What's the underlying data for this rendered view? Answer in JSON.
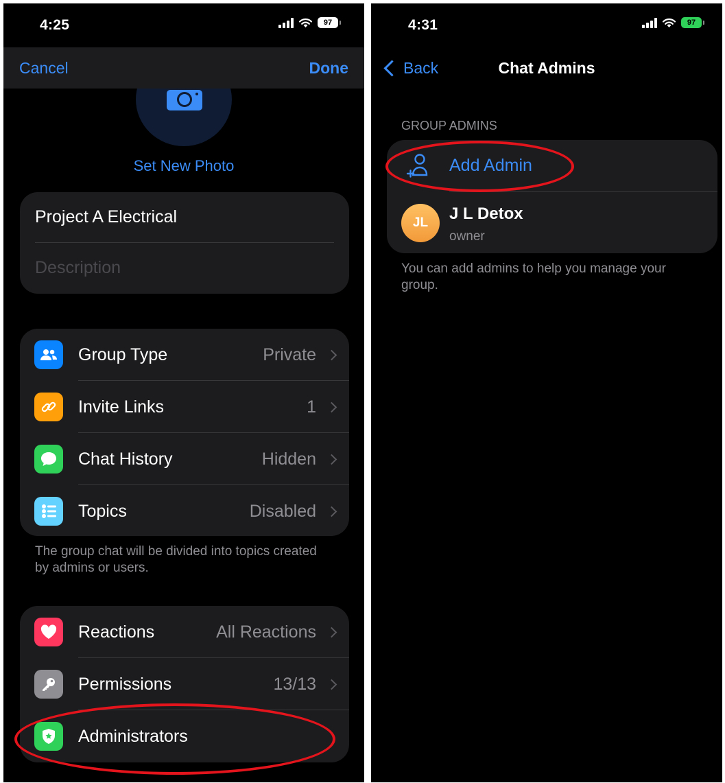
{
  "left_screen": {
    "status": {
      "time": "4:25",
      "battery": "97"
    },
    "nav": {
      "cancel_label": "Cancel",
      "done_label": "Done"
    },
    "photo": {
      "set_new_photo_label": "Set New Photo"
    },
    "name_field": {
      "value": "Project A Electrical",
      "description_placeholder": "Description"
    },
    "settings": [
      {
        "label": "Group Type",
        "value": "Private",
        "icon": "group-icon",
        "color": "#0a84ff"
      },
      {
        "label": "Invite Links",
        "value": "1",
        "icon": "link-icon",
        "color": "#ff9f0a"
      },
      {
        "label": "Chat History",
        "value": "Hidden",
        "icon": "chat-bubble-icon",
        "color": "#30d158"
      },
      {
        "label": "Topics",
        "value": "Disabled",
        "icon": "topics-list-icon",
        "color": "#64d2ff"
      }
    ],
    "topics_footnote": "The group chat will be divided into topics created by admins or users.",
    "admin_settings": [
      {
        "label": "Reactions",
        "value": "All Reactions",
        "icon": "heart-icon",
        "color": "#ff375f"
      },
      {
        "label": "Permissions",
        "value": "13/13",
        "icon": "key-icon",
        "color": "#8e8e93"
      },
      {
        "label": "Administrators",
        "value": "",
        "icon": "shield-icon",
        "color": "#30d158"
      }
    ]
  },
  "right_screen": {
    "status": {
      "time": "4:31",
      "battery": "97"
    },
    "nav": {
      "back_label": "Back",
      "title": "Chat Admins"
    },
    "section_header": "GROUP ADMINS",
    "add_admin_label": "Add Admin",
    "admins": [
      {
        "initials": "JL",
        "name": "J L Detox",
        "role": "owner"
      }
    ],
    "footnote": "You can add admins to help you manage your group."
  },
  "colors": {
    "accent": "#3b8cf6",
    "highlight_ring": "#e3141b",
    "cell": "#1c1c1e"
  }
}
